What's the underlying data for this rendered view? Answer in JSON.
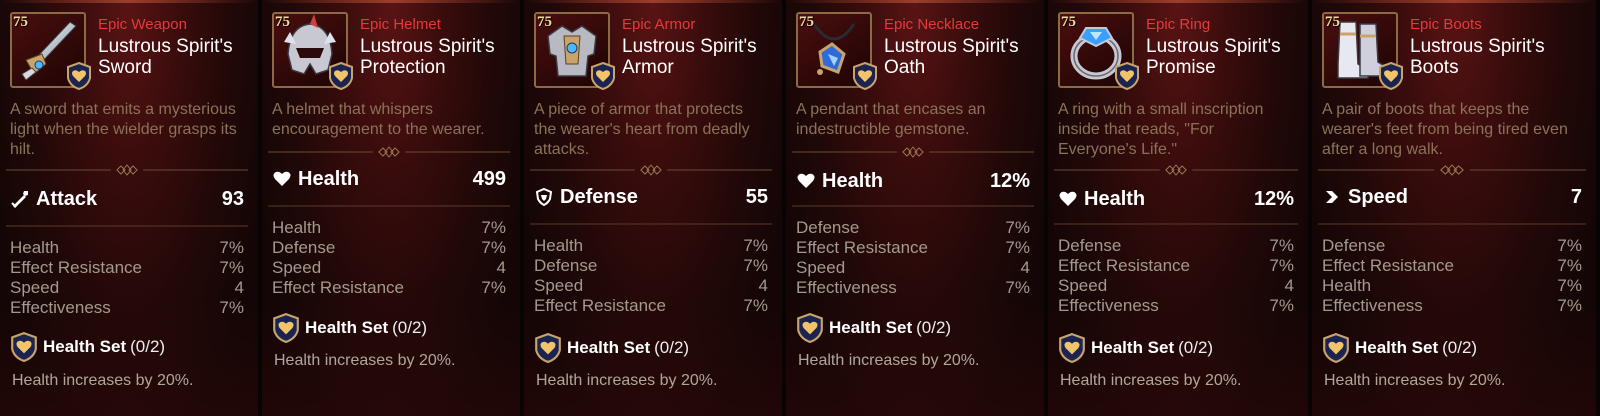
{
  "cards": [
    {
      "level": "75",
      "rarity": "Epic Weapon",
      "name_line1": "Lustrous Spirit's",
      "name_line2": "Sword",
      "icon": "sword-icon",
      "description": "A sword that emits a mysterious light when the wielder grasps its hilt.",
      "main_stat": {
        "icon": "attack-icon",
        "name": "Attack",
        "value": "93"
      },
      "substats": [
        {
          "name": "Health",
          "value": "7%"
        },
        {
          "name": "Effect Resistance",
          "value": "7%"
        },
        {
          "name": "Speed",
          "value": "4"
        },
        {
          "name": "Effectiveness",
          "value": "7%"
        }
      ],
      "set_name": "Health Set",
      "set_count": "(0/2)",
      "set_effect": "Health increases by 20%."
    },
    {
      "level": "75",
      "rarity": "Epic Helmet",
      "name_line1": "Lustrous Spirit's",
      "name_line2": "Protection",
      "icon": "helmet-icon",
      "description": "A helmet that whispers encouragement to the wearer.",
      "main_stat": {
        "icon": "health-icon",
        "name": "Health",
        "value": "499"
      },
      "substats": [
        {
          "name": "Health",
          "value": "7%"
        },
        {
          "name": "Defense",
          "value": "7%"
        },
        {
          "name": "Speed",
          "value": "4"
        },
        {
          "name": "Effect Resistance",
          "value": "7%"
        }
      ],
      "set_name": "Health Set",
      "set_count": "(0/2)",
      "set_effect": "Health increases by 20%."
    },
    {
      "level": "75",
      "rarity": "Epic Armor",
      "name_line1": "Lustrous Spirit's",
      "name_line2": "Armor",
      "icon": "armor-icon",
      "description": "A piece of armor that protects the wearer's heart from deadly attacks.",
      "main_stat": {
        "icon": "defense-icon",
        "name": "Defense",
        "value": "55"
      },
      "substats": [
        {
          "name": "Health",
          "value": "7%"
        },
        {
          "name": "Defense",
          "value": "7%"
        },
        {
          "name": "Speed",
          "value": "4"
        },
        {
          "name": "Effect Resistance",
          "value": "7%"
        }
      ],
      "set_name": "Health Set",
      "set_count": "(0/2)",
      "set_effect": "Health increases by 20%."
    },
    {
      "level": "75",
      "rarity": "Epic Necklace",
      "name_line1": "Lustrous Spirit's",
      "name_line2": "Oath",
      "icon": "necklace-icon",
      "description": "A pendant that encases an indestructible gemstone.",
      "main_stat": {
        "icon": "health-icon",
        "name": "Health",
        "value": "12%"
      },
      "substats": [
        {
          "name": "Defense",
          "value": "7%"
        },
        {
          "name": "Effect Resistance",
          "value": "7%"
        },
        {
          "name": "Speed",
          "value": "4"
        },
        {
          "name": "Effectiveness",
          "value": "7%"
        }
      ],
      "set_name": "Health Set",
      "set_count": "(0/2)",
      "set_effect": "Health increases by 20%."
    },
    {
      "level": "75",
      "rarity": "Epic Ring",
      "name_line1": "Lustrous Spirit's",
      "name_line2": "Promise",
      "icon": "ring-icon",
      "description": "A ring with a small inscription inside that reads, \"For Everyone's Life.\"",
      "main_stat": {
        "icon": "health-icon",
        "name": "Health",
        "value": "12%"
      },
      "substats": [
        {
          "name": "Defense",
          "value": "7%"
        },
        {
          "name": "Effect Resistance",
          "value": "7%"
        },
        {
          "name": "Speed",
          "value": "4"
        },
        {
          "name": "Effectiveness",
          "value": "7%"
        }
      ],
      "set_name": "Health Set",
      "set_count": "(0/2)",
      "set_effect": "Health increases by 20%."
    },
    {
      "level": "75",
      "rarity": "Epic Boots",
      "name_line1": "Lustrous Spirit's",
      "name_line2": "Boots",
      "icon": "boots-icon",
      "description": "A pair of boots that keeps the wearer's feet from being tired even after a long walk.",
      "main_stat": {
        "icon": "speed-icon",
        "name": "Speed",
        "value": "7"
      },
      "substats": [
        {
          "name": "Defense",
          "value": "7%"
        },
        {
          "name": "Effect Resistance",
          "value": "7%"
        },
        {
          "name": "Health",
          "value": "7%"
        },
        {
          "name": "Effectiveness",
          "value": "7%"
        }
      ],
      "set_name": "Health Set",
      "set_count": "(0/2)",
      "set_effect": "Health increases by 20%."
    }
  ],
  "colors": {
    "rarity": "#e23b3b",
    "description": "#8b7258",
    "substat": "#a39a8e",
    "accent_gold": "#c9a46a"
  }
}
